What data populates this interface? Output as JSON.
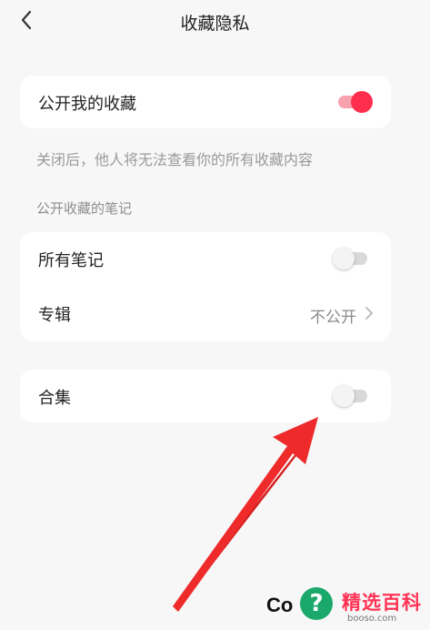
{
  "header": {
    "title": "收藏隐私"
  },
  "favorites_card": {
    "label": "公开我的收藏",
    "toggle_on": true
  },
  "hint": "关闭后，他人将无法查看你的所有收藏内容",
  "section_title": "公开收藏的笔记",
  "notes_card": {
    "all_notes_label": "所有笔记",
    "all_notes_toggle_on": false,
    "album_label": "专辑",
    "album_value": "不公开"
  },
  "collection_card": {
    "label": "合集",
    "toggle_on": false
  },
  "colors": {
    "accent": "#ff2e4d",
    "accent_track": "#f8a2b0",
    "arrow": "#ee2a2a"
  },
  "watermark": {
    "co_text": "Co",
    "cn_text": "精选百科",
    "en_text": "booso.com"
  }
}
